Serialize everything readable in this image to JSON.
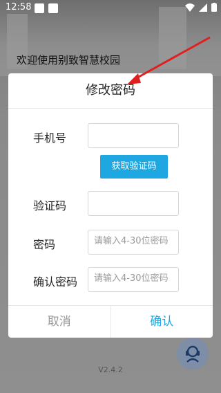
{
  "status_bar": {
    "time": "12:58"
  },
  "background": {
    "welcome_text": "欢迎使用别致智慧校园",
    "version": "V2.4.2"
  },
  "modal": {
    "title": "修改密码",
    "phone_label": "手机号",
    "phone_value": "",
    "get_code_label": "获取验证码",
    "code_label": "验证码",
    "code_value": "",
    "password_label": "密码",
    "password_placeholder": "请输入4-30位密码",
    "confirm_password_label": "确认密码",
    "confirm_password_placeholder": "请输入4-30位密码",
    "cancel_label": "取消",
    "confirm_label": "确认"
  },
  "colors": {
    "accent": "#1ea7e1",
    "annotation_arrow": "#e02020"
  }
}
